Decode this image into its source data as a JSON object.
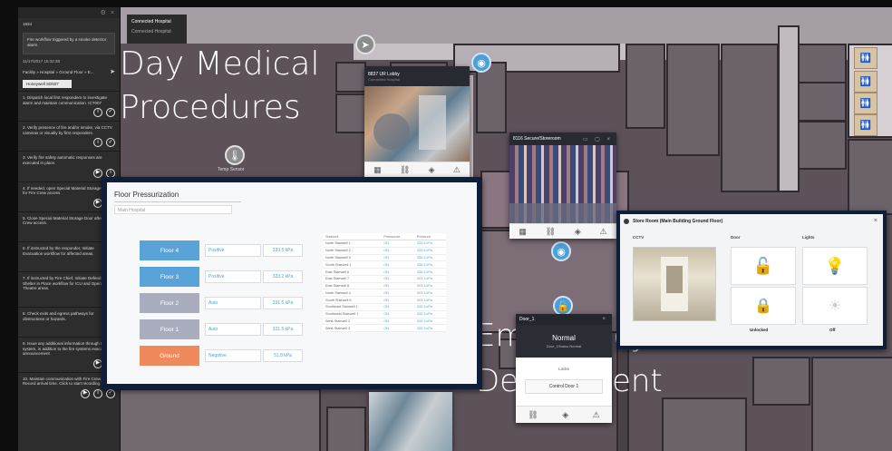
{
  "sidebar": {
    "incident_id": "1834",
    "message": "Fire workflow triggered by a smoke detector alarm.",
    "datetime": "11/17/2017 15:32:38",
    "location": "Facility » Hospital » Ground Floor » E...",
    "device_tag": "Honeywell SD507",
    "steps": [
      {
        "text": "1. Dispatch local first responders to investigate alarm and maintain communication. ICT007"
      },
      {
        "text": "2. Verify presence of fire and/or smoke, via CCTV cameras or visually by first responders."
      },
      {
        "text": "3. Verify fire safety automatic responses are executed in place."
      },
      {
        "text": "4. If needed, open Special Material Storage Door for Fire Crew access"
      },
      {
        "text": "5. Close Special Material Storage Door after Fire Crew access."
      },
      {
        "text": "6. If instructed by the responder, Initiate Evacuation workflow for affected areas."
      },
      {
        "text": "7. If instructed by Fire Chief, Initiate Defend and Shelter in Place workflow for ICU and Operation Theatre areas."
      },
      {
        "text": "8. Check exits and egress pathways for obstructions or hazards."
      },
      {
        "text": "9. Issue any additional information through the PA system, in addition to the fire systems evacuation announcement"
      },
      {
        "text": "10. Maintain communication with Fire Crew. Record arrival time. Click to start recording."
      }
    ]
  },
  "map": {
    "badge_title": "Connected Hospital",
    "badge_sub": "Connected Hospital",
    "title_day_1": "Day Medical",
    "title_day_2": "Procedures",
    "title_em_1": "Emergency",
    "title_em_2": "Department",
    "sensor_label": "Temp Sensor"
  },
  "floor_pressurization": {
    "title": "Floor Pressurization",
    "subtitle": "Main Hospital",
    "floors": [
      {
        "label": "Floor 4",
        "mode": "Positive",
        "value": "333.5 kPa",
        "color": "#5aa3d8"
      },
      {
        "label": "Floor 3",
        "mode": "Positive",
        "value": "333.2 kPa",
        "color": "#5aa3d8"
      },
      {
        "label": "Floor 2",
        "mode": "Auto",
        "value": "331.5 kPa",
        "color": "#a9adbd"
      },
      {
        "label": "Floor 1",
        "mode": "Auto",
        "value": "331.5 kPa",
        "color": "#a9adbd"
      },
      {
        "label": "Ground",
        "mode": "Negative",
        "value": "51.8 kPa",
        "color": "#f08a5d"
      }
    ],
    "table_headers": [
      "Stairwell",
      "Pressurize",
      "Pressure"
    ],
    "table_rows": [
      [
        "North Stairwell 1",
        "ON",
        "333.5 kPa"
      ],
      [
        "North Stairwell 2",
        "ON",
        "333.5 kPa"
      ],
      [
        "North Stairwell 3",
        "ON",
        "333.3 kPa"
      ],
      [
        "South Stairwell 1",
        "ON",
        "333.3 kPa"
      ],
      [
        "East Stairwell 6",
        "ON",
        "333.3 kPa"
      ],
      [
        "East Stairwell 7",
        "ON",
        "333.3 kPa"
      ],
      [
        "East Stairwell 8",
        "ON",
        "333.3 kPa"
      ],
      [
        "North Stairwell 4",
        "ON",
        "333.3 kPa"
      ],
      [
        "South Stairwell 5",
        "ON",
        "333.3 kPa"
      ],
      [
        "Southeast Stairwell 1",
        "ON",
        "333.3 kPa"
      ],
      [
        "Southwest Stairwell 1",
        "ON",
        "333.3 kPa"
      ],
      [
        "West Stairwell 2",
        "ON",
        "333.3 kPa"
      ],
      [
        "West Stairwell 3",
        "ON",
        "333.3 kPa"
      ]
    ]
  },
  "cam1": {
    "title": "8837 UR Lobby",
    "sub": "Connected Hospital"
  },
  "cam2": {
    "title": "8116 Secure/Storeroom",
    "sub": ""
  },
  "store_room": {
    "title": "Store Room (Main Building Ground Floor)",
    "col_cctv": "CCTV",
    "col_door": "Door",
    "col_lights": "Lights",
    "door_state": "Unlocked",
    "lights_state": "Off"
  },
  "door_panel": {
    "title": "Door_1",
    "status": "Normal",
    "status_sub": "Door_1Status Normal",
    "mode_label": "Locks",
    "action": "Control Door 1"
  },
  "colors": {
    "accent": "#4d9fd6",
    "panel_dark": "#0f1f3a",
    "ground": "#f08a5d"
  }
}
